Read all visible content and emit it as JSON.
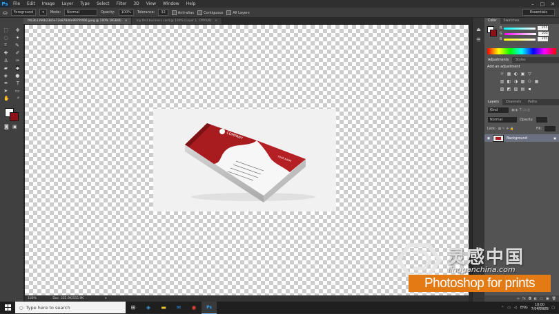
{
  "app": {
    "logo": "Ps"
  },
  "menu": [
    "File",
    "Edit",
    "Image",
    "Layer",
    "Type",
    "Select",
    "Filter",
    "3D",
    "View",
    "Window",
    "Help"
  ],
  "window_controls": [
    "–",
    "□",
    "✕"
  ],
  "options": {
    "sample": "Foreground",
    "mode_label": "Mode:",
    "mode_value": "Normal",
    "opacity_label": "Opacity:",
    "opacity_value": "100%",
    "tolerance_label": "Tolerance:",
    "tolerance_value": "32",
    "anti_alias": "Anti-alias",
    "contiguous": "Contiguous",
    "all_layers": "All Layers",
    "workspace": "Essentials"
  },
  "tabs": [
    {
      "label": "f4b3b1396b23b5e72e878d0e9979f496.jpeg @ 100% (RGB/8)",
      "active": true
    },
    {
      "label": "my first business card @ 100% (Layer 1, CMYK/8)",
      "active": false
    }
  ],
  "status": {
    "zoom": "100%",
    "doc": "Doc: 555.9K/555.9K"
  },
  "color_panel": {
    "tabs": [
      "Color",
      "Swatches"
    ],
    "channels": [
      {
        "name": "R",
        "value": "255",
        "gradient": "#e04040"
      },
      {
        "name": "G",
        "value": "255",
        "gradient": "#40c040"
      },
      {
        "name": "B",
        "value": "255",
        "gradient": "#4040e0"
      }
    ]
  },
  "adjustments_panel": {
    "tabs": [
      "Adjustments",
      "Styles"
    ],
    "heading": "Add an adjustment",
    "icons_row1": [
      "☼",
      "▦",
      "◐",
      "▣",
      "▽"
    ],
    "icons_row2": [
      "▥",
      "◧",
      "◑",
      "▩",
      "⚇",
      "▦"
    ],
    "icons_row3": [
      "▨",
      "◩",
      "▧",
      "▤",
      "▪"
    ]
  },
  "layers_panel": {
    "tabs": [
      "Layers",
      "Channels",
      "Paths"
    ],
    "kind_label": "Kind",
    "blend_mode": "Normal",
    "opacity_label": "Opacity:",
    "lock_label": "Lock:",
    "fill_label": "Fill:",
    "layers": [
      {
        "name": "Background",
        "visible_icon": "◉",
        "lock_icon": "🔒"
      }
    ]
  },
  "watermark": {
    "chinese": "灵感中国",
    "url": "lingganchina.com",
    "banner": "Photoshop for prints",
    "udemy": "Udemy"
  },
  "taskbar": {
    "search_placeholder": "Type here to search",
    "search_icon": "○",
    "apps": [
      "⊞",
      "◈",
      "▬",
      "✉",
      "◉",
      "Ps"
    ],
    "tray_lang": "ENG",
    "time": "10:00",
    "date": "7/04/2021"
  },
  "business_card": {
    "brand": "COMPANY",
    "name": "YOUR NAME",
    "job": "Job Title"
  }
}
